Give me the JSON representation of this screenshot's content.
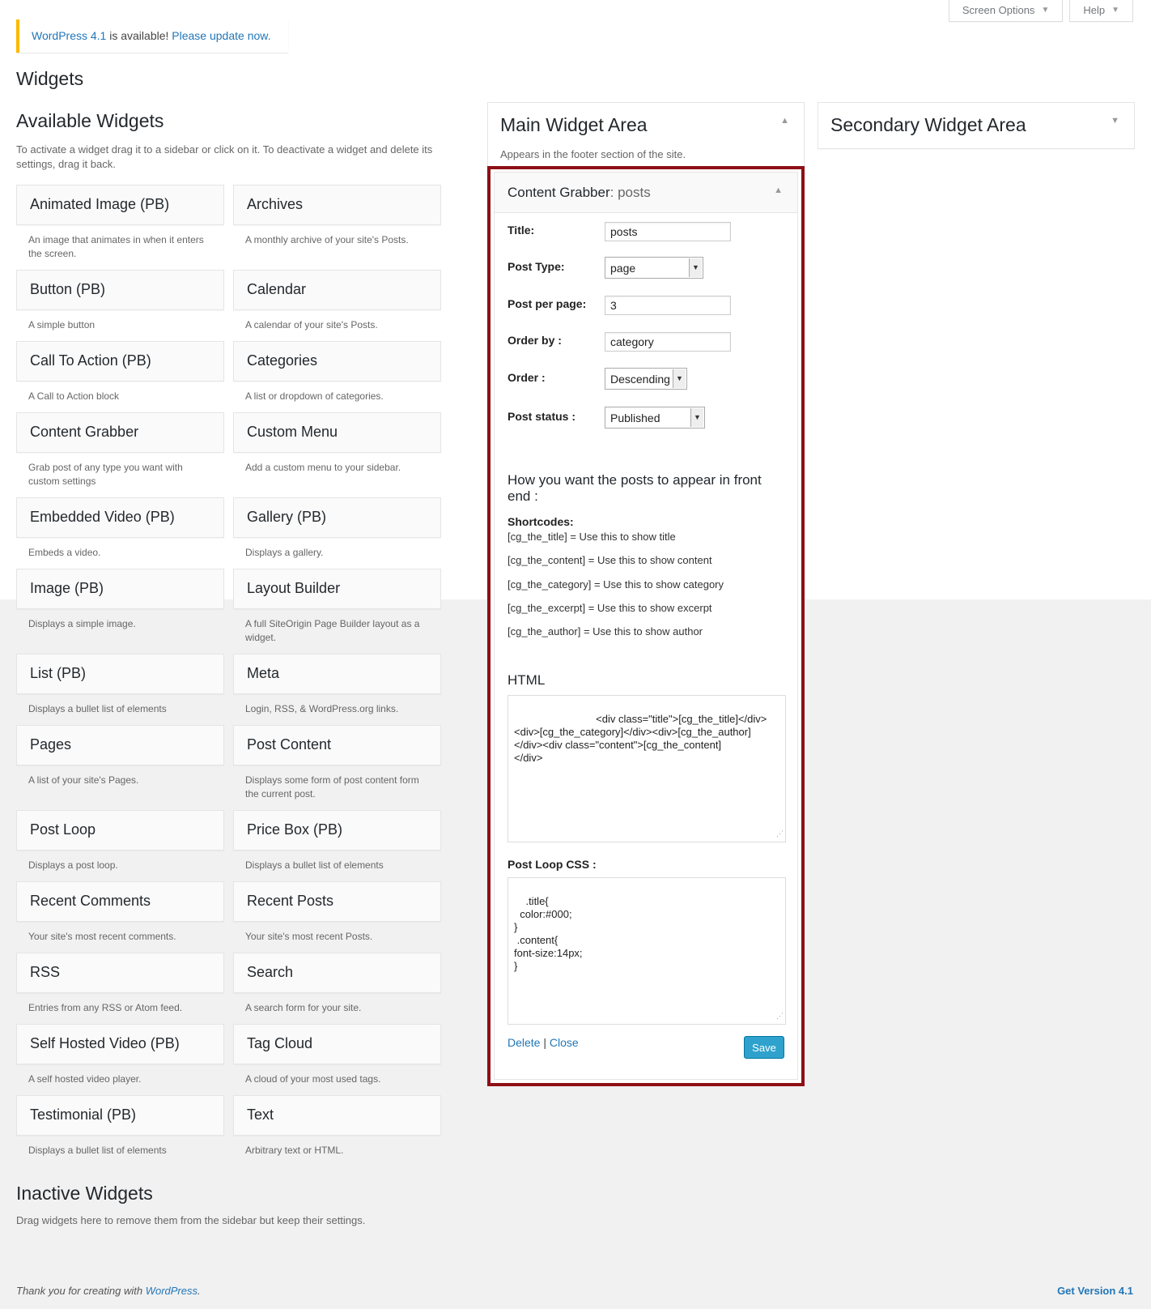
{
  "screen_meta": {
    "screen_options": "Screen Options",
    "help": "Help"
  },
  "update_nag": {
    "link1": "WordPress 4.1",
    "text": " is available! ",
    "link2": "Please update now."
  },
  "page_title": "Widgets",
  "available": {
    "title": "Available Widgets",
    "description": "To activate a widget drag it to a sidebar or click on it. To deactivate a widget and delete its settings, drag it back.",
    "rows": [
      [
        {
          "name": "Animated Image (PB)",
          "desc": "An image that animates in when it enters the screen."
        },
        {
          "name": "Archives",
          "desc": "A monthly archive of your site's Posts."
        }
      ],
      [
        {
          "name": "Button (PB)",
          "desc": "A simple button"
        },
        {
          "name": "Calendar",
          "desc": "A calendar of your site's Posts."
        }
      ],
      [
        {
          "name": "Call To Action (PB)",
          "desc": "A Call to Action block"
        },
        {
          "name": "Categories",
          "desc": "A list or dropdown of categories."
        }
      ],
      [
        {
          "name": "Content Grabber",
          "desc": "Grab post of any type you want with custom settings"
        },
        {
          "name": "Custom Menu",
          "desc": "Add a custom menu to your sidebar."
        }
      ],
      [
        {
          "name": "Embedded Video (PB)",
          "desc": "Embeds a video."
        },
        {
          "name": "Gallery (PB)",
          "desc": "Displays a gallery."
        }
      ],
      [
        {
          "name": "Image (PB)",
          "desc": "Displays a simple image."
        },
        {
          "name": "Layout Builder",
          "desc": "A full SiteOrigin Page Builder layout as a widget."
        }
      ],
      [
        {
          "name": "List (PB)",
          "desc": "Displays a bullet list of elements"
        },
        {
          "name": "Meta",
          "desc": "Login, RSS, & WordPress.org links."
        }
      ],
      [
        {
          "name": "Pages",
          "desc": "A list of your site's Pages."
        },
        {
          "name": "Post Content",
          "desc": "Displays some form of post content form the current post."
        }
      ],
      [
        {
          "name": "Post Loop",
          "desc": "Displays a post loop."
        },
        {
          "name": "Price Box (PB)",
          "desc": "Displays a bullet list of elements"
        }
      ],
      [
        {
          "name": "Recent Comments",
          "desc": "Your site's most recent comments."
        },
        {
          "name": "Recent Posts",
          "desc": "Your site's most recent Posts."
        }
      ],
      [
        {
          "name": "RSS",
          "desc": "Entries from any RSS or Atom feed."
        },
        {
          "name": "Search",
          "desc": "A search form for your site."
        }
      ],
      [
        {
          "name": "Self Hosted Video (PB)",
          "desc": "A self hosted video player."
        },
        {
          "name": "Tag Cloud",
          "desc": "A cloud of your most used tags."
        }
      ],
      [
        {
          "name": "Testimonial (PB)",
          "desc": "Displays a bullet list of elements"
        },
        {
          "name": "Text",
          "desc": "Arbitrary text or HTML."
        }
      ]
    ]
  },
  "main_area": {
    "title": "Main Widget Area",
    "desc": "Appears in the footer section of the site."
  },
  "secondary_area": {
    "title": "Secondary Widget Area"
  },
  "content_grabber": {
    "head_title": "Content Grabber",
    "head_sub": ": posts",
    "title_label": "Title:",
    "title_value": "posts",
    "post_type_label": "Post Type:",
    "post_type_value": "page",
    "per_page_label": "Post per page:",
    "per_page_value": "3",
    "order_by_label": "Order by :",
    "order_by_value": "category",
    "order_label": "Order :",
    "order_value": "Descending",
    "status_label": "Post status :",
    "status_value": "Published",
    "how_title": "How you want the posts to appear in front end :",
    "shortcodes_title": "Shortcodes:",
    "shortcodes": [
      "[cg_the_title] = Use this to show title",
      "[cg_the_content] = Use this to show content",
      "[cg_the_category] = Use this to show category",
      "[cg_the_excerpt] = Use this to show excerpt",
      "[cg_the_author] = Use this to show author"
    ],
    "html_title": "HTML",
    "html_value": "                        <div class=\"title\">[cg_the_title]</div>\n<div>[cg_the_category]</div><div>[cg_the_author]\n</div><div class=\"content\">[cg_the_content]\n</div>",
    "css_label": "Post Loop CSS :",
    "css_value": ".title{\n  color:#000;\n}\n .content{\nfont-size:14px;\n}",
    "delete": "Delete",
    "sep": " | ",
    "close": "Close",
    "save": "Save"
  },
  "inactive": {
    "title": "Inactive Widgets",
    "desc": "Drag widgets here to remove them from the sidebar but keep their settings."
  },
  "footer": {
    "thanks": "Thank you for creating with ",
    "wp_link": "WordPress",
    "period": ".",
    "version": "Get Version 4.1"
  },
  "colors": {
    "accent": "#2276b7",
    "highlight": "#8e0f16",
    "nag": "#ffba00",
    "save": "#2ea2cc"
  }
}
